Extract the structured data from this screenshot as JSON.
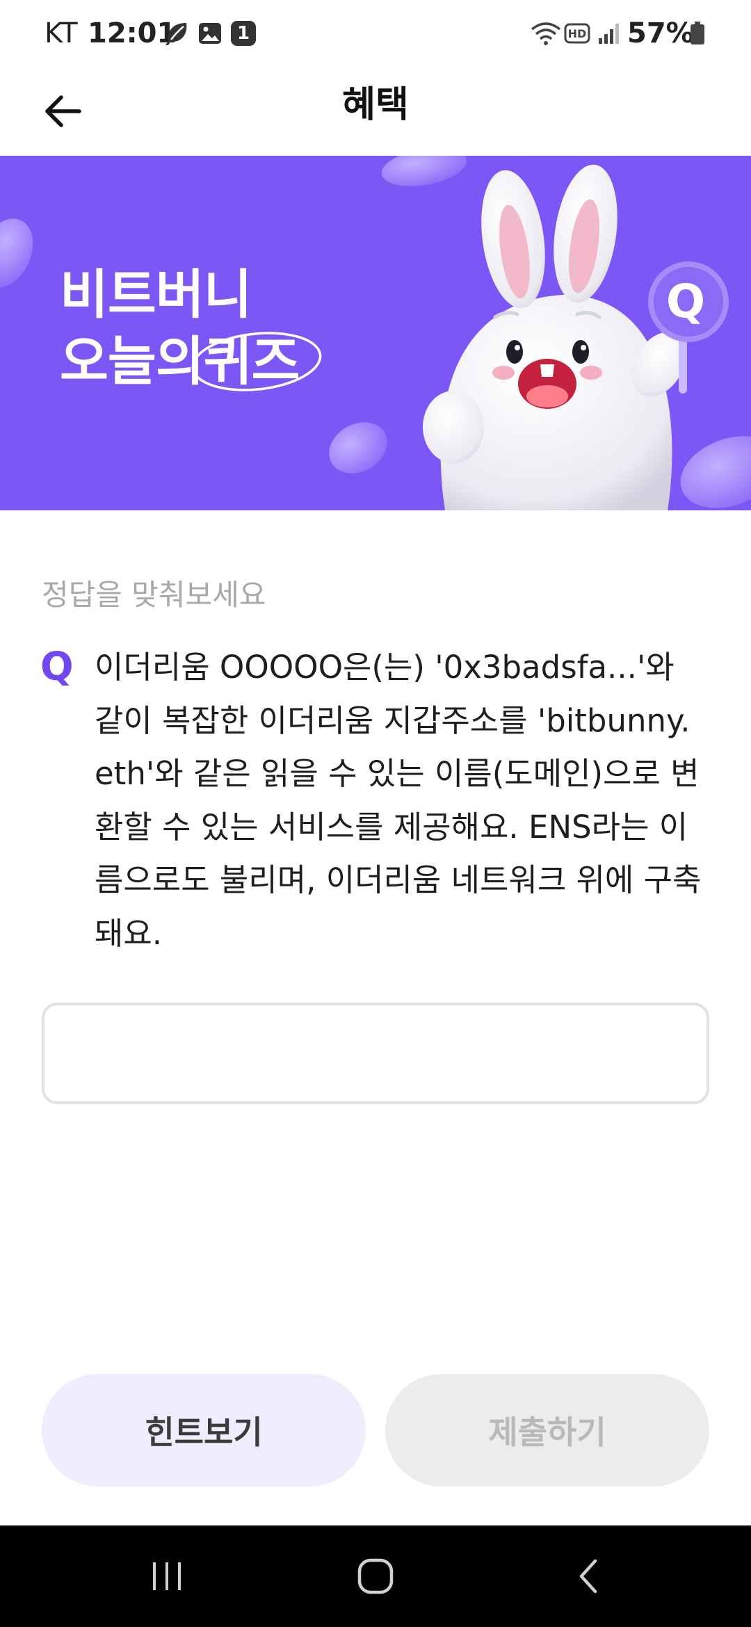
{
  "status_bar": {
    "carrier": "KT",
    "time": "12:01",
    "notification_badge": "1",
    "hd_label": "HD",
    "battery": "57%"
  },
  "header": {
    "title": "혜택"
  },
  "banner": {
    "title_line1": "비트버니",
    "title_line2_prefix": "오늘의",
    "title_line2_highlight": "퀴즈",
    "badge_letter": "Q"
  },
  "quiz": {
    "prompt": "정답을 맞춰보세요",
    "q_mark": "Q",
    "question": "이더리움 OOOOO은(는) '0x3badsfa...'와 같이 복잡한 이더리움 지갑주소를 'bitbunny.eth'와 같은 읽을 수 있는 이름(도메인)으로 변환할 수 있는 서비스를 제공해요. ENS라는 이름으로도 불리며, 이더리움 네트워크 위에 구축돼요.",
    "answer_value": ""
  },
  "buttons": {
    "hint": "힌트보기",
    "submit": "제출하기"
  },
  "colors": {
    "banner_bg": "#7c57f5",
    "accent": "#7446f0",
    "hint_bg": "#efedfd",
    "submit_disabled_bg": "#ececec"
  },
  "icons": {
    "back": "arrow-left-icon",
    "nav_recent": "recent-apps-icon",
    "nav_home": "home-icon",
    "nav_back": "chevron-left-icon"
  }
}
